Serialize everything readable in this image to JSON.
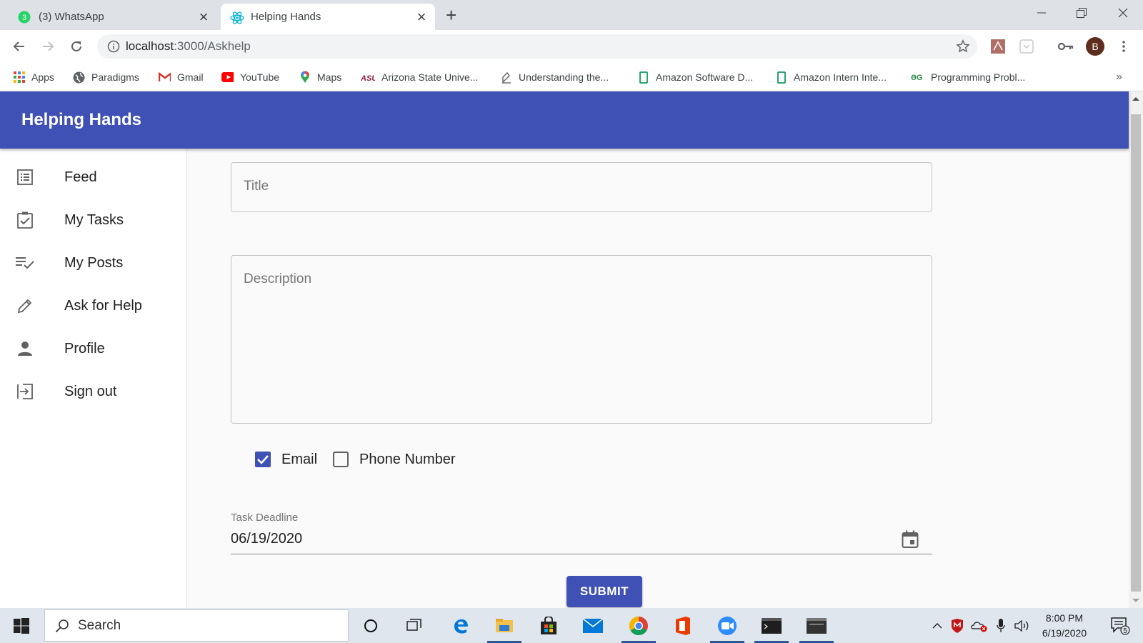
{
  "browser": {
    "tabs": [
      {
        "label": "(3) WhatsApp",
        "badge": "3",
        "active": false
      },
      {
        "label": "Helping Hands",
        "active": true
      }
    ],
    "url_host": "localhost",
    "url_path": ":3000/Askhelp",
    "profile_initial": "B",
    "bookmarks": [
      {
        "label": "Apps",
        "icon": "apps-grid-icon"
      },
      {
        "label": "Paradigms",
        "icon": "globe-icon"
      },
      {
        "label": "Gmail",
        "icon": "gmail-icon"
      },
      {
        "label": "YouTube",
        "icon": "youtube-icon"
      },
      {
        "label": "Maps",
        "icon": "maps-pin-icon"
      },
      {
        "label": "Arizona State Unive...",
        "icon": "asu-icon"
      },
      {
        "label": "Understanding the...",
        "icon": "page-icon"
      },
      {
        "label": "Amazon Software D...",
        "icon": "doc-green-icon"
      },
      {
        "label": "Amazon Intern Inte...",
        "icon": "doc-green-icon"
      },
      {
        "label": "Programming Probl...",
        "icon": "gfg-icon"
      }
    ],
    "more": "»"
  },
  "app": {
    "title": "Helping Hands",
    "brand_color": "#3f51b5",
    "nav": [
      {
        "label": "Feed",
        "icon": "list-icon"
      },
      {
        "label": "My Tasks",
        "icon": "checkbox-icon"
      },
      {
        "label": "My Posts",
        "icon": "playlist-check-icon"
      },
      {
        "label": "Ask for Help",
        "icon": "pencil-icon"
      },
      {
        "label": "Profile",
        "icon": "person-icon"
      },
      {
        "label": "Sign out",
        "icon": "exit-icon"
      }
    ],
    "form": {
      "title_placeholder": "Title",
      "description_placeholder": "Description",
      "contact_email_label": "Email",
      "contact_email_checked": true,
      "contact_phone_label": "Phone Number",
      "contact_phone_checked": false,
      "deadline_label": "Task Deadline",
      "deadline_value": "06/19/2020",
      "submit_label": "SUBMIT"
    }
  },
  "taskbar": {
    "search_placeholder": "Search",
    "time": "8:00 PM",
    "date": "6/19/2020",
    "notifications": "5"
  }
}
